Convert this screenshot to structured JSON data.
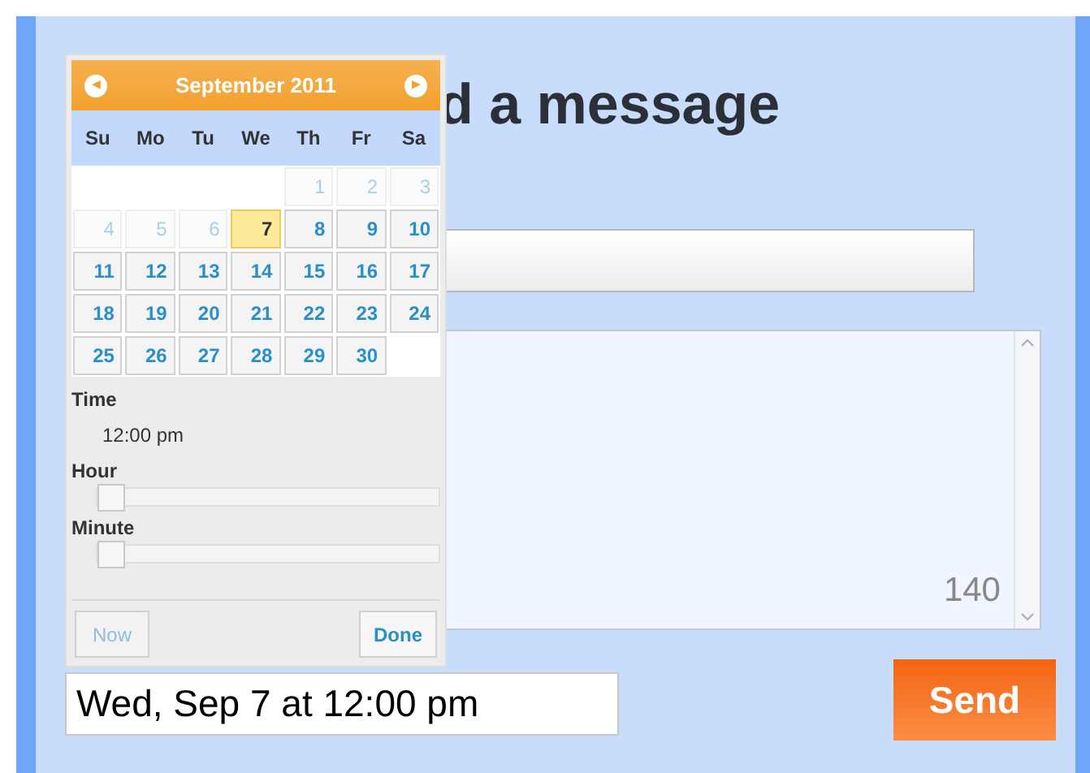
{
  "heading": "d a message",
  "message": {
    "counter": "140"
  },
  "datetime_field": {
    "value": "Wed, Sep 7 at 12:00 pm"
  },
  "send_button": "Send",
  "calendar": {
    "prev": "◀",
    "next": "▶",
    "month": "September 2011",
    "weekdays": [
      "Su",
      "Mo",
      "Tu",
      "We",
      "Th",
      "Fr",
      "Sa"
    ],
    "weeks": [
      [
        {
          "kind": "blank"
        },
        {
          "kind": "blank"
        },
        {
          "kind": "blank"
        },
        {
          "kind": "blank"
        },
        {
          "day": "1",
          "disabled": true,
          "selected": false
        },
        {
          "day": "2",
          "disabled": true,
          "selected": false
        },
        {
          "day": "3",
          "disabled": true,
          "selected": false
        }
      ],
      [
        {
          "day": "4",
          "disabled": true,
          "selected": false
        },
        {
          "day": "5",
          "disabled": true,
          "selected": false
        },
        {
          "day": "6",
          "disabled": true,
          "selected": false
        },
        {
          "day": "7",
          "disabled": false,
          "selected": true
        },
        {
          "day": "8",
          "disabled": false,
          "selected": false
        },
        {
          "day": "9",
          "disabled": false,
          "selected": false
        },
        {
          "day": "10",
          "disabled": false,
          "selected": false
        }
      ],
      [
        {
          "day": "11",
          "disabled": false,
          "selected": false
        },
        {
          "day": "12",
          "disabled": false,
          "selected": false
        },
        {
          "day": "13",
          "disabled": false,
          "selected": false
        },
        {
          "day": "14",
          "disabled": false,
          "selected": false
        },
        {
          "day": "15",
          "disabled": false,
          "selected": false
        },
        {
          "day": "16",
          "disabled": false,
          "selected": false
        },
        {
          "day": "17",
          "disabled": false,
          "selected": false
        }
      ],
      [
        {
          "day": "18",
          "disabled": false,
          "selected": false
        },
        {
          "day": "19",
          "disabled": false,
          "selected": false
        },
        {
          "day": "20",
          "disabled": false,
          "selected": false
        },
        {
          "day": "21",
          "disabled": false,
          "selected": false
        },
        {
          "day": "22",
          "disabled": false,
          "selected": false
        },
        {
          "day": "23",
          "disabled": false,
          "selected": false
        },
        {
          "day": "24",
          "disabled": false,
          "selected": false
        }
      ],
      [
        {
          "day": "25",
          "disabled": false,
          "selected": false
        },
        {
          "day": "26",
          "disabled": false,
          "selected": false
        },
        {
          "day": "27",
          "disabled": false,
          "selected": false
        },
        {
          "day": "28",
          "disabled": false,
          "selected": false
        },
        {
          "day": "29",
          "disabled": false,
          "selected": false
        },
        {
          "day": "30",
          "disabled": false,
          "selected": false
        },
        {
          "kind": "blank"
        }
      ]
    ],
    "time_label": "Time",
    "time_value": "12:00 pm",
    "sliders": [
      {
        "label": "Hour",
        "level": 0
      },
      {
        "label": "Minute",
        "level": 0
      }
    ],
    "now_button": {
      "label": "Now",
      "disabled": true
    },
    "done_button": {
      "label": "Done",
      "disabled": false
    }
  }
}
